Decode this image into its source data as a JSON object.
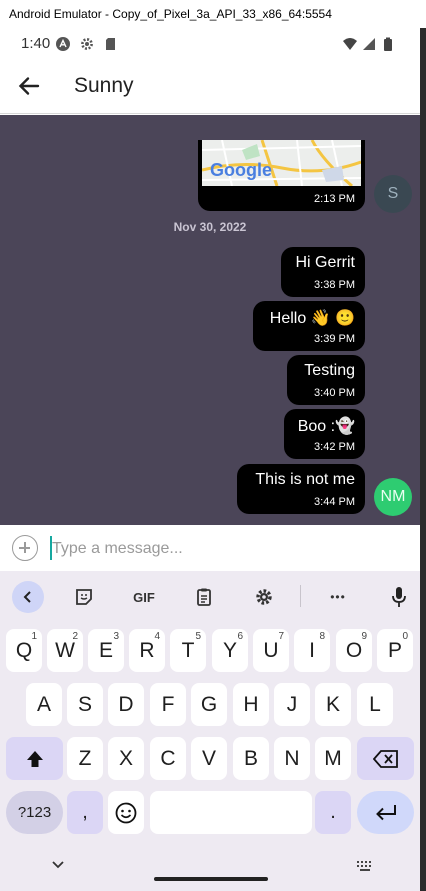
{
  "window": {
    "title": "Android Emulator - Copy_of_Pixel_3a_API_33_x86_64:5554"
  },
  "status_bar": {
    "time": "1:40",
    "icons": [
      "notification-a-icon",
      "settings-gear-icon",
      "sd-card-icon",
      "wifi-icon",
      "cell-signal-icon",
      "battery-icon"
    ]
  },
  "app_bar": {
    "title": "Sunny",
    "back_icon": "arrow-left-icon"
  },
  "chat": {
    "background_color": "#4b4558",
    "map_message": {
      "logo_text": "Google",
      "time": "2:13 PM"
    },
    "contact_avatar": {
      "initial": "S",
      "color": "#3a4852"
    },
    "date_separator": "Nov 30, 2022",
    "messages": [
      {
        "text": "Hi Gerrit",
        "time": "3:38 PM"
      },
      {
        "text": "Hello 👋 🙂",
        "time": "3:39 PM"
      },
      {
        "text": "Testing",
        "time": "3:40 PM"
      },
      {
        "text": "Boo :👻",
        "time": "3:42 PM"
      },
      {
        "text": "This is not me",
        "time": "3:44 PM"
      }
    ],
    "my_avatar": {
      "initials": "NM",
      "color": "#2ecc71"
    }
  },
  "composer": {
    "placeholder": "Type a message..."
  },
  "keyboard": {
    "toolbar": {
      "gif_label": "GIF",
      "more_label": "•••"
    },
    "row1": [
      {
        "key": "Q",
        "hint": "1"
      },
      {
        "key": "W",
        "hint": "2"
      },
      {
        "key": "E",
        "hint": "3"
      },
      {
        "key": "R",
        "hint": "4"
      },
      {
        "key": "T",
        "hint": "5"
      },
      {
        "key": "Y",
        "hint": "6"
      },
      {
        "key": "U",
        "hint": "7"
      },
      {
        "key": "I",
        "hint": "8"
      },
      {
        "key": "O",
        "hint": "9"
      },
      {
        "key": "P",
        "hint": "0"
      }
    ],
    "row2": [
      "A",
      "S",
      "D",
      "F",
      "G",
      "H",
      "J",
      "K",
      "L"
    ],
    "row3": [
      "Z",
      "X",
      "C",
      "V",
      "B",
      "N",
      "M"
    ],
    "symbols_label": "?123",
    "comma_label": ",",
    "period_label": ".",
    "emoji_icon": "smiley-icon"
  }
}
